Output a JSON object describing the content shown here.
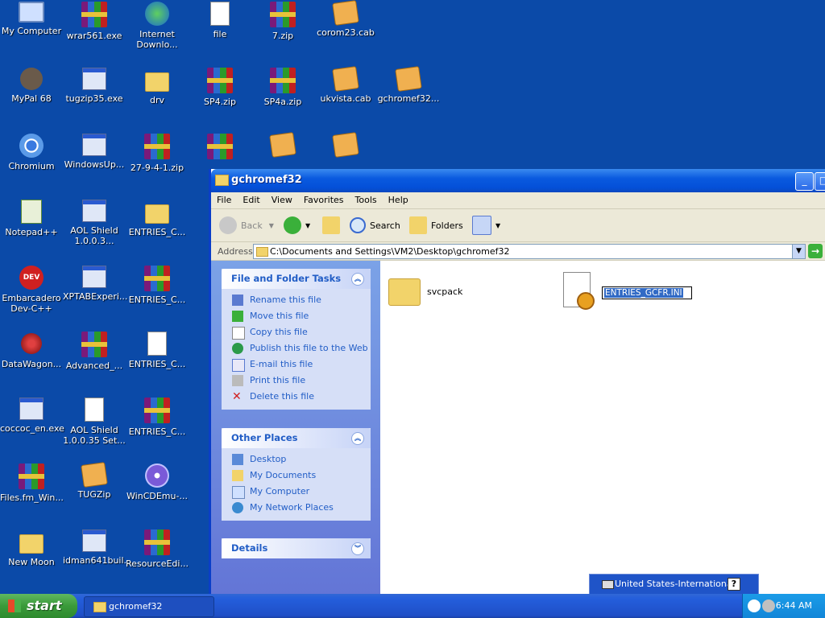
{
  "desktop": {
    "icons": [
      {
        "label": "My Computer",
        "icon": "computer-icon"
      },
      {
        "label": "wrar561.exe",
        "icon": "winrar-icon"
      },
      {
        "label": "Internet Downlo...",
        "icon": "idm-icon"
      },
      {
        "label": "file",
        "icon": "file-icon"
      },
      {
        "label": "7.zip",
        "icon": "winrar-icon"
      },
      {
        "label": "corom23.cab",
        "icon": "cab-icon"
      },
      {
        "label": "MyPal 68",
        "icon": "mypal-icon"
      },
      {
        "label": "tugzip35.exe",
        "icon": "installer-icon"
      },
      {
        "label": "drv",
        "icon": "folder-icon"
      },
      {
        "label": "SP4.zip",
        "icon": "winrar-icon"
      },
      {
        "label": "SP4a.zip",
        "icon": "winrar-icon"
      },
      {
        "label": "ukvista.cab",
        "icon": "cab-icon"
      },
      {
        "label": "gchromef32...",
        "icon": "cab-icon"
      },
      {
        "label": "Chromium",
        "icon": "chromium-icon"
      },
      {
        "label": "WindowsUp...",
        "icon": "window-icon"
      },
      {
        "label": "27-9-4-1.zip",
        "icon": "winrar-icon"
      },
      {
        "label": "Notepad++",
        "icon": "notepadpp-icon"
      },
      {
        "label": "AOL Shield 1.0.0.3...",
        "icon": "window-icon"
      },
      {
        "label": "ENTRIES_C...",
        "icon": "folder-icon"
      },
      {
        "label": "Embarcadero Dev-C++",
        "icon": "devcpp-icon"
      },
      {
        "label": "XPTABExperi...",
        "icon": "installer-icon"
      },
      {
        "label": "ENTRIES_C...",
        "icon": "winrar-icon"
      },
      {
        "label": "DataWagon...",
        "icon": "datawagon-icon"
      },
      {
        "label": "Advanced_...",
        "icon": "winrar-icon"
      },
      {
        "label": "ENTRIES_C...",
        "icon": "file-icon"
      },
      {
        "label": "coccoc_en.exe",
        "icon": "installer-icon"
      },
      {
        "label": "AOL Shield 1.0.0.35 Set...",
        "icon": "file-icon"
      },
      {
        "label": "ENTRIES_C...",
        "icon": "winrar-icon"
      },
      {
        "label": "Files.fm_Win...",
        "icon": "winrar-icon"
      },
      {
        "label": "TUGZip",
        "icon": "cab-icon"
      },
      {
        "label": "WinCDEmu-...",
        "icon": "cd-icon"
      },
      {
        "label": "New Moon",
        "icon": "folder-icon"
      },
      {
        "label": "idman641buil...",
        "icon": "installer-icon"
      },
      {
        "label": "ResourceEdi...",
        "icon": "winrar-icon"
      }
    ]
  },
  "window": {
    "title": "gchromef32",
    "menu": [
      "File",
      "Edit",
      "View",
      "Favorites",
      "Tools",
      "Help"
    ],
    "toolbar": {
      "back": "Back",
      "search": "Search",
      "folders": "Folders"
    },
    "address": {
      "label": "Address",
      "path": "C:\\Documents and Settings\\VM2\\Desktop\\gchromef32"
    },
    "tasks_panel": {
      "title": "File and Folder Tasks",
      "items": [
        "Rename this file",
        "Move this file",
        "Copy this file",
        "Publish this file to the Web",
        "E-mail this file",
        "Print this file",
        "Delete this file"
      ]
    },
    "places_panel": {
      "title": "Other Places",
      "items": [
        "Desktop",
        "My Documents",
        "My Computer",
        "My Network Places"
      ]
    },
    "details_panel": {
      "title": "Details"
    },
    "files": [
      {
        "name": "svcpack",
        "type": "folder"
      },
      {
        "name": "ENTRIES_GCFR.INI",
        "type": "ini",
        "renaming": true
      }
    ]
  },
  "language_bar": {
    "label": "United States-International",
    "help": "?"
  },
  "taskbar": {
    "start": "start",
    "items": [
      {
        "label": "gchromef32"
      }
    ],
    "clock": "6:44 AM"
  },
  "colors": {
    "desktop": "#0b4aa8",
    "xp_blue": "#0a5adf",
    "task_link": "#215dc6",
    "start_green": "#3a9a3a"
  }
}
